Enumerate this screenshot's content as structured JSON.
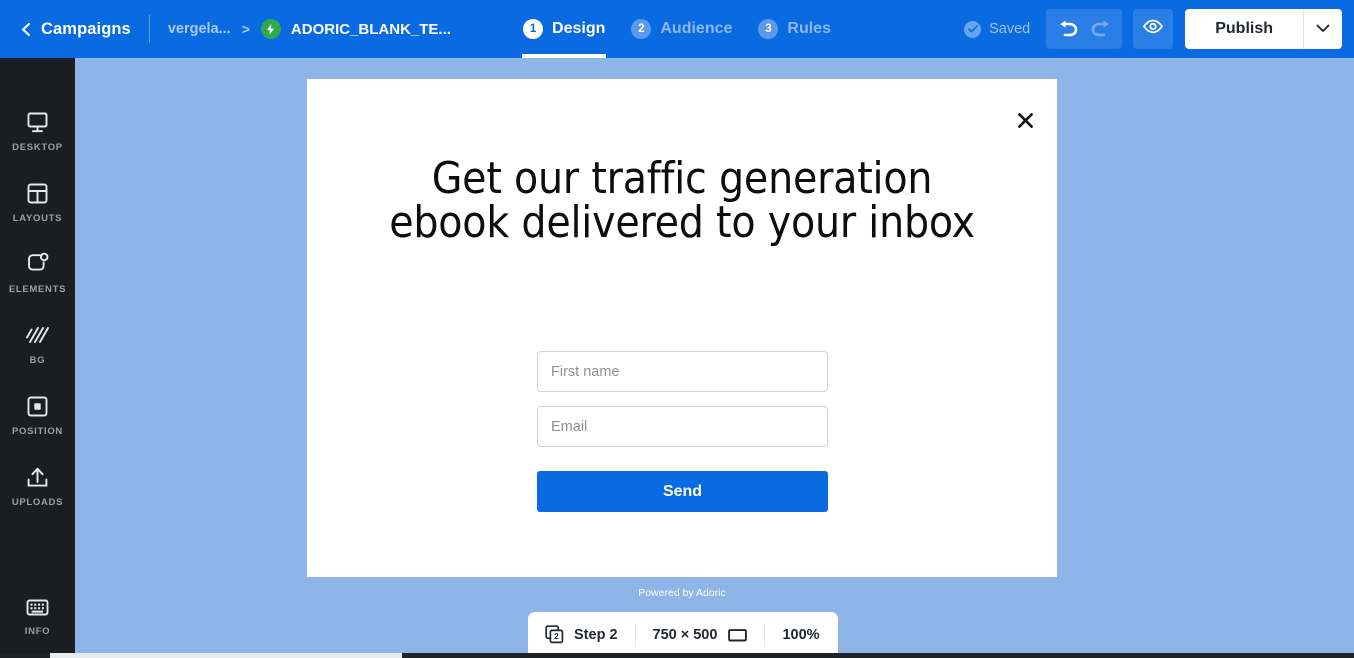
{
  "header": {
    "back_icon": "chevron-left-icon",
    "campaigns_label": "Campaigns",
    "breadcrumb_parent": "vergela...",
    "breadcrumb_separator": ">",
    "bolt_icon": "lightning-bolt-icon",
    "breadcrumb_current": "ADORIC_BLANK_TE...",
    "steps": [
      {
        "num": "1",
        "label": "Design",
        "active": true
      },
      {
        "num": "2",
        "label": "Audience",
        "active": false
      },
      {
        "num": "3",
        "label": "Rules",
        "active": false
      }
    ],
    "saved": {
      "icon": "check-circle-icon",
      "label": "Saved"
    },
    "undo_icon": "undo-arrow-icon",
    "redo_icon": "redo-arrow-icon",
    "preview_icon": "eye-icon",
    "publish_label": "Publish",
    "publish_caret_icon": "chevron-down-icon",
    "accent_blue": "#0a6ae1",
    "bolt_green": "#2fa84f"
  },
  "sidebar": {
    "items": [
      {
        "icon": "monitor-icon",
        "label": "DESKTOP"
      },
      {
        "icon": "layout-grid-icon",
        "label": "LAYOUTS"
      },
      {
        "icon": "elements-shape-icon",
        "label": "ELEMENTS"
      },
      {
        "icon": "hatch-pattern-icon",
        "label": "BG"
      },
      {
        "icon": "position-square-icon",
        "label": "POSITION"
      },
      {
        "icon": "upload-arrow-icon",
        "label": "UPLOADS"
      },
      {
        "icon": "keyboard-info-icon",
        "label": "INFO"
      }
    ],
    "background_color": "#1a1d22"
  },
  "canvas": {
    "background_color": "#8fb5e8",
    "popup": {
      "close_icon": "close-x-icon",
      "title": "Get our traffic generation ebook delivered to your inbox",
      "title_line1": "Get our traffic generation",
      "title_line2": "ebook delivered to your inbox",
      "fields": [
        {
          "name": "first-name",
          "placeholder": "First name",
          "value": ""
        },
        {
          "name": "email",
          "placeholder": "Email",
          "value": ""
        }
      ],
      "submit_label": "Send",
      "submit_color": "#0a6ae1",
      "background_color": "#ffffff"
    },
    "powered_by": "Powered by Adoric"
  },
  "bottom_bar": {
    "layers_icon": "layers-copy-icon",
    "step_label": "Step 2",
    "step_badge": "2",
    "dimensions": "750 × 500",
    "width": "750",
    "height": "500",
    "resize_icon": "rectangle-icon",
    "zoom": "100%"
  }
}
